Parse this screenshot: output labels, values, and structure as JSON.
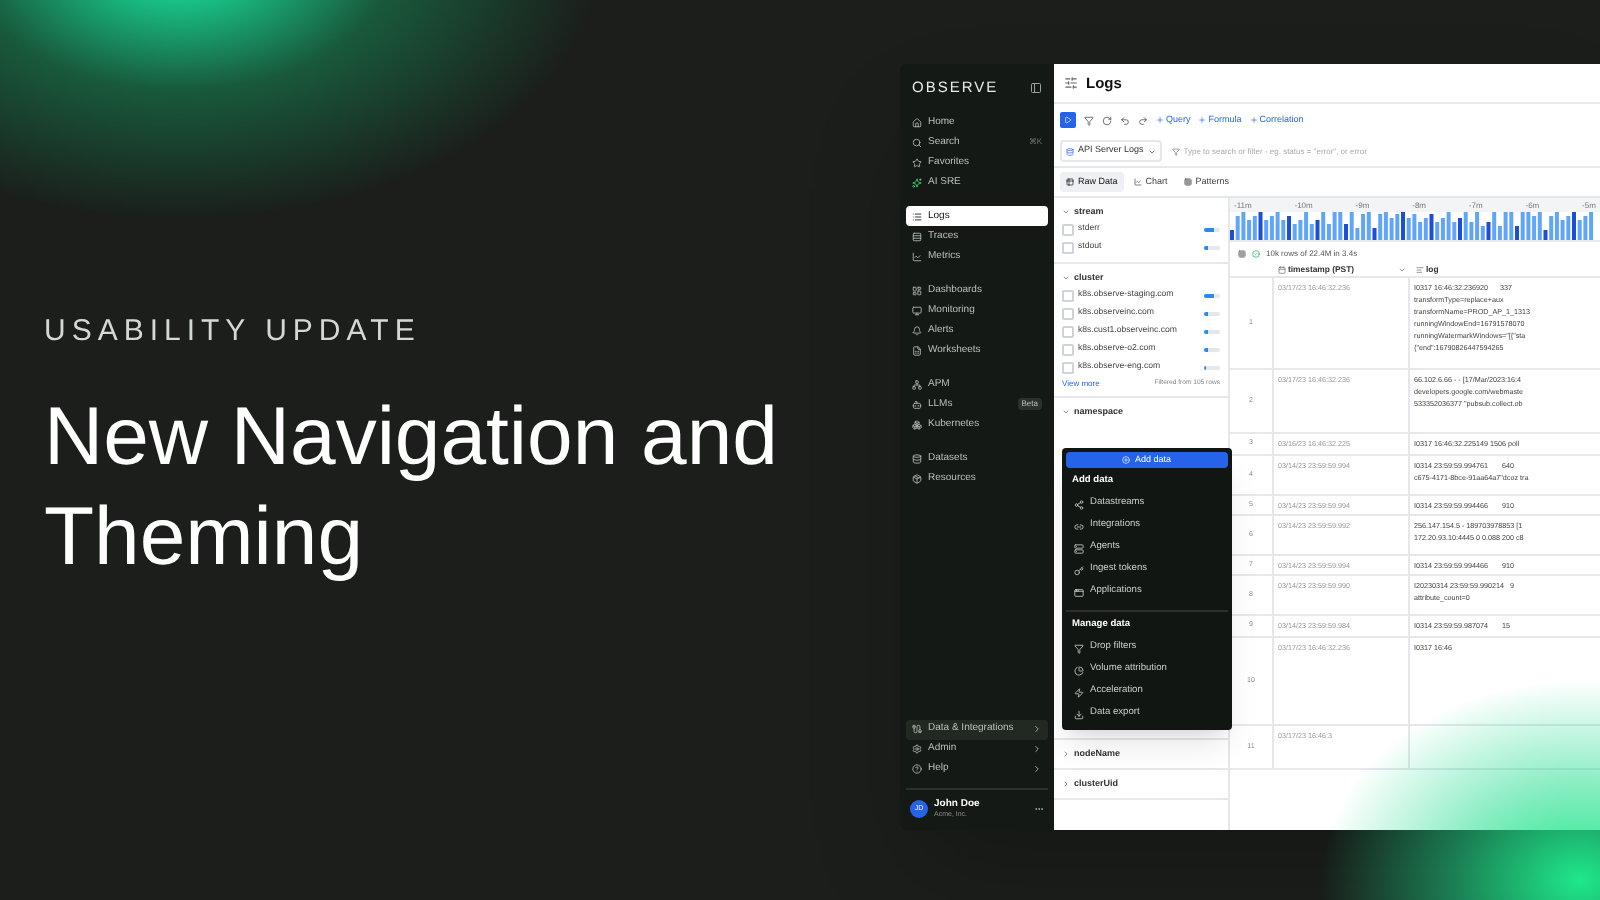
{
  "hero": {
    "eyebrow": "USABILITY UPDATE",
    "headline": "New Navigation and Theming"
  },
  "sidebar": {
    "logo": "OBSERVE",
    "groups": [
      [
        {
          "label": "Home",
          "selected": false
        },
        {
          "label": "Search",
          "selected": false,
          "shortcut": "⌘K"
        },
        {
          "label": "Favorites",
          "selected": false
        },
        {
          "label": "AI SRE",
          "selected": false
        }
      ],
      [
        {
          "label": "Logs",
          "selected": true
        },
        {
          "label": "Traces",
          "selected": false
        },
        {
          "label": "Metrics",
          "selected": false
        }
      ],
      [
        {
          "label": "Dashboards",
          "selected": false
        },
        {
          "label": "Monitoring",
          "selected": false
        },
        {
          "label": "Alerts",
          "selected": false
        },
        {
          "label": "Worksheets",
          "selected": false
        }
      ],
      [
        {
          "label": "APM",
          "selected": false
        },
        {
          "label": "LLMs",
          "selected": false,
          "badge": "Beta"
        },
        {
          "label": "Kubernetes",
          "selected": false
        }
      ],
      [
        {
          "label": "Datasets",
          "selected": false
        },
        {
          "label": "Resources",
          "selected": false
        }
      ]
    ],
    "bottom_items": [
      {
        "label": "Data & Integrations",
        "selected": true
      },
      {
        "label": "Admin",
        "selected": false
      },
      {
        "label": "Help",
        "selected": false
      }
    ],
    "user": {
      "initials": "JD",
      "name": "John Doe",
      "org": "Acme, Inc."
    }
  },
  "page_title": "Logs",
  "toolbar": {
    "actions": [
      "Query",
      "Formula",
      "Correlation"
    ]
  },
  "dataset": {
    "name": "API Server Logs"
  },
  "search": {
    "placeholder": "Type to search or filter - eg. status = \"error\", or error"
  },
  "view_tabs": [
    {
      "label": "Raw Data",
      "selected": true
    },
    {
      "label": "Chart",
      "selected": false
    },
    {
      "label": "Patterns",
      "selected": false
    }
  ],
  "filters": [
    {
      "name": "stream",
      "expanded": true,
      "values": [
        {
          "label": "stderr",
          "checked": false,
          "level": 0.6
        },
        {
          "label": "stdout",
          "checked": false,
          "level": 0.3
        }
      ]
    },
    {
      "name": "cluster",
      "expanded": true,
      "values": [
        {
          "label": "k8s.observe-staging.com",
          "checked": false,
          "level": 0.6
        },
        {
          "label": "k8s.observeinc.com",
          "checked": false,
          "level": 0.3
        },
        {
          "label": "k8s.cust1.observeinc.com",
          "checked": false,
          "level": 0.25
        },
        {
          "label": "k8s.observe-o2.com",
          "checked": false,
          "level": 0.2
        },
        {
          "label": "k8s.observe-eng.com",
          "checked": false,
          "level": 0.15
        }
      ],
      "view_more": "View more",
      "note": "Filtered from 105 rows"
    },
    {
      "name": "namespace",
      "expanded": true
    },
    {
      "name": "nodeName",
      "expanded": false
    },
    {
      "name": "clusterUid",
      "expanded": false
    }
  ],
  "histogram": {
    "ticks": [
      "-11m",
      "-10m",
      "-9m",
      "-8m",
      "-7m",
      "-6m",
      "-5m"
    ]
  },
  "status": "10k rows of 22.4M in 3.4s",
  "columns": [
    "timestamp (PST)",
    "log"
  ],
  "rows": [
    {
      "index": "1",
      "timestamp": "03/17/23 16:46:32.236",
      "log": [
        "I0317 16:46:32.236920      337",
        "transformType=replace+aux",
        "transformName=PROD_AP_1_1313",
        "runningWindowEnd=16791578070",
        "runningWatermarkWindows=\"[{\"sta",
        "{\"end\":16790826447594265"
      ]
    },
    {
      "index": "2",
      "timestamp": "03/17/23 16:46:32.236",
      "log": [
        "66.102.6.66 - - [17/Mar/2023:16:4",
        "developers.google.com/webmaste",
        "533352036377 \"pubsub.collect.ob"
      ]
    },
    {
      "index": "3",
      "timestamp": "03/16/23 16:46:32.225",
      "log": [
        "I0317 16:46:32.225149 1506 poll"
      ]
    },
    {
      "index": "4",
      "timestamp": "03/14/23 23:59:59.994",
      "log": [
        "I0314 23:59:59.994761       640",
        "c675-4171-8bce-91aa64a7\"dcoz tra"
      ]
    },
    {
      "index": "5",
      "timestamp": "03/14/23 23:59:59.994",
      "log": [
        "I0314 23:59:59.994466       910"
      ]
    },
    {
      "index": "6",
      "timestamp": "03/14/23 23:59:59.992",
      "log": [
        "256.147.154.5 - 189703978853 [1",
        "172.20.93.10:4445 0 0.088 200 c8"
      ]
    },
    {
      "index": "7",
      "timestamp": "03/14/23 23:59:59.994",
      "log": [
        "I0314 23:59:59.994466       910"
      ]
    },
    {
      "index": "8",
      "timestamp": "03/14/23 23:59:59.990",
      "log": [
        "I20230314 23:59:59.990214   9",
        "attribute_count=0"
      ]
    },
    {
      "index": "9",
      "timestamp": "03/14/23 23:59:59.984",
      "log": [
        "I0314 23:59:59.987074       15"
      ]
    },
    {
      "index": "10",
      "timestamp": "03/17/23 16:46:32.236",
      "log": [
        "I0317 16:46"
      ]
    },
    {
      "index": "11",
      "timestamp": "03/17/23 16:46:3",
      "log": []
    }
  ],
  "menu": {
    "button": "Add data",
    "sections": [
      {
        "title": "Add data",
        "items": [
          "Datastreams",
          "Integrations",
          "Agents",
          "Ingest tokens",
          "Applications"
        ]
      },
      {
        "title": "Manage data",
        "items": [
          "Drop filters",
          "Volume attribution",
          "Acceleration",
          "Data export"
        ]
      }
    ]
  }
}
